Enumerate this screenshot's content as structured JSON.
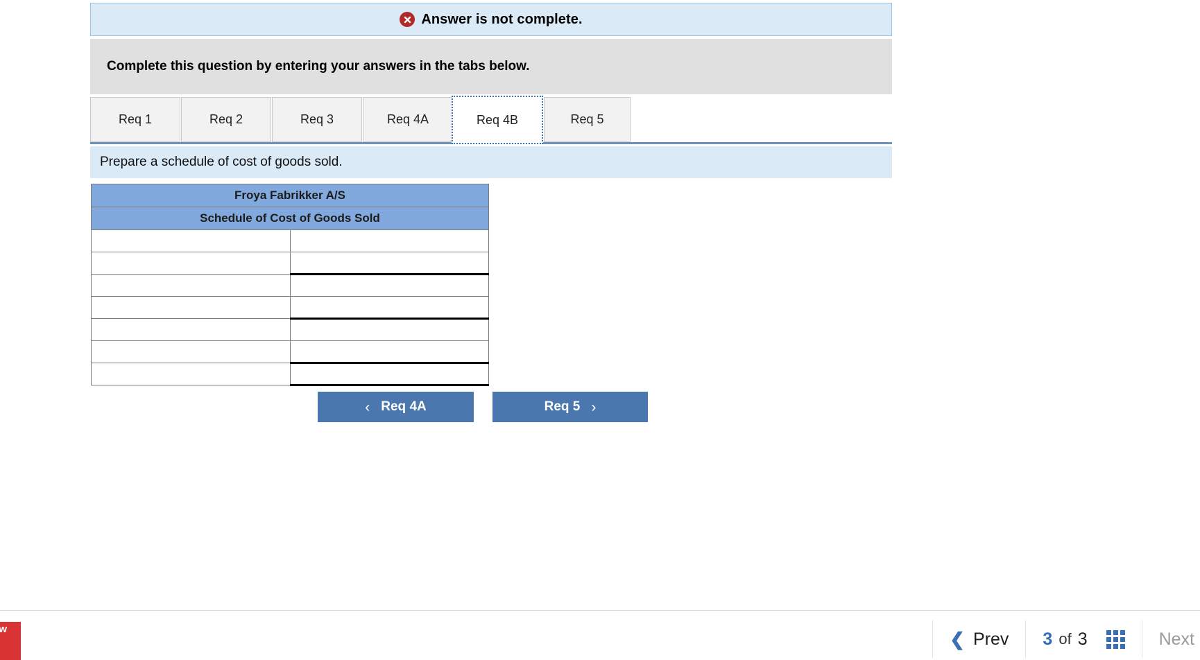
{
  "alert": {
    "icon": "error-circle-x-icon",
    "message": "Answer is not complete.",
    "bg_color": "#daeaf7",
    "border_color": "#9dc3e6",
    "icon_color": "#b02a28"
  },
  "instruction": {
    "text": "Complete this question by entering your answers in the tabs below.",
    "bg_color": "#e0e0e0"
  },
  "tabs": {
    "items": [
      {
        "label": "Req 1",
        "active": false
      },
      {
        "label": "Req 2",
        "active": false
      },
      {
        "label": "Req 3",
        "active": false
      },
      {
        "label": "Req 4A",
        "active": false
      },
      {
        "label": "Req 4B",
        "active": true
      },
      {
        "label": "Req 5",
        "active": false
      }
    ],
    "active_index": 4,
    "active_border_color": "#3f72b5"
  },
  "prompt": {
    "text": "Prepare a schedule of cost of goods sold.",
    "bg_color": "#daeaf7"
  },
  "worksheet": {
    "header_bg": "#82a9dd",
    "title_line_1": "Froya Fabrikker A/S",
    "title_line_2": "Schedule of Cost of Goods Sold",
    "columns": [
      "",
      ""
    ],
    "rows": [
      {
        "label": "",
        "value": "",
        "value_rule_top": false,
        "value_rule_bottom": false
      },
      {
        "label": "",
        "value": "",
        "value_rule_top": false,
        "value_rule_bottom": true
      },
      {
        "label": "",
        "value": "",
        "value_rule_top": false,
        "value_rule_bottom": false
      },
      {
        "label": "",
        "value": "",
        "value_rule_top": false,
        "value_rule_bottom": true
      },
      {
        "label": "",
        "value": "",
        "value_rule_top": false,
        "value_rule_bottom": false
      },
      {
        "label": "",
        "value": "",
        "value_rule_top": false,
        "value_rule_bottom": true
      },
      {
        "label": "",
        "value": "",
        "value_rule_top": false,
        "value_rule_bottom": true
      }
    ]
  },
  "nav": {
    "prev_label": "Req 4A",
    "next_label": "Req 5",
    "prev_chevron": "chevron-left-icon",
    "next_chevron": "chevron-right-icon",
    "button_color": "#4a77ad"
  },
  "bottombar": {
    "tag_text": "aw",
    "tag_color": "#d93434",
    "prev_label": "Prev",
    "page_current": "3",
    "page_of": "of",
    "page_total": "3",
    "grid_icon": "grid-menu-icon",
    "next_label": "Next",
    "accent_color": "#3b6fb5"
  }
}
